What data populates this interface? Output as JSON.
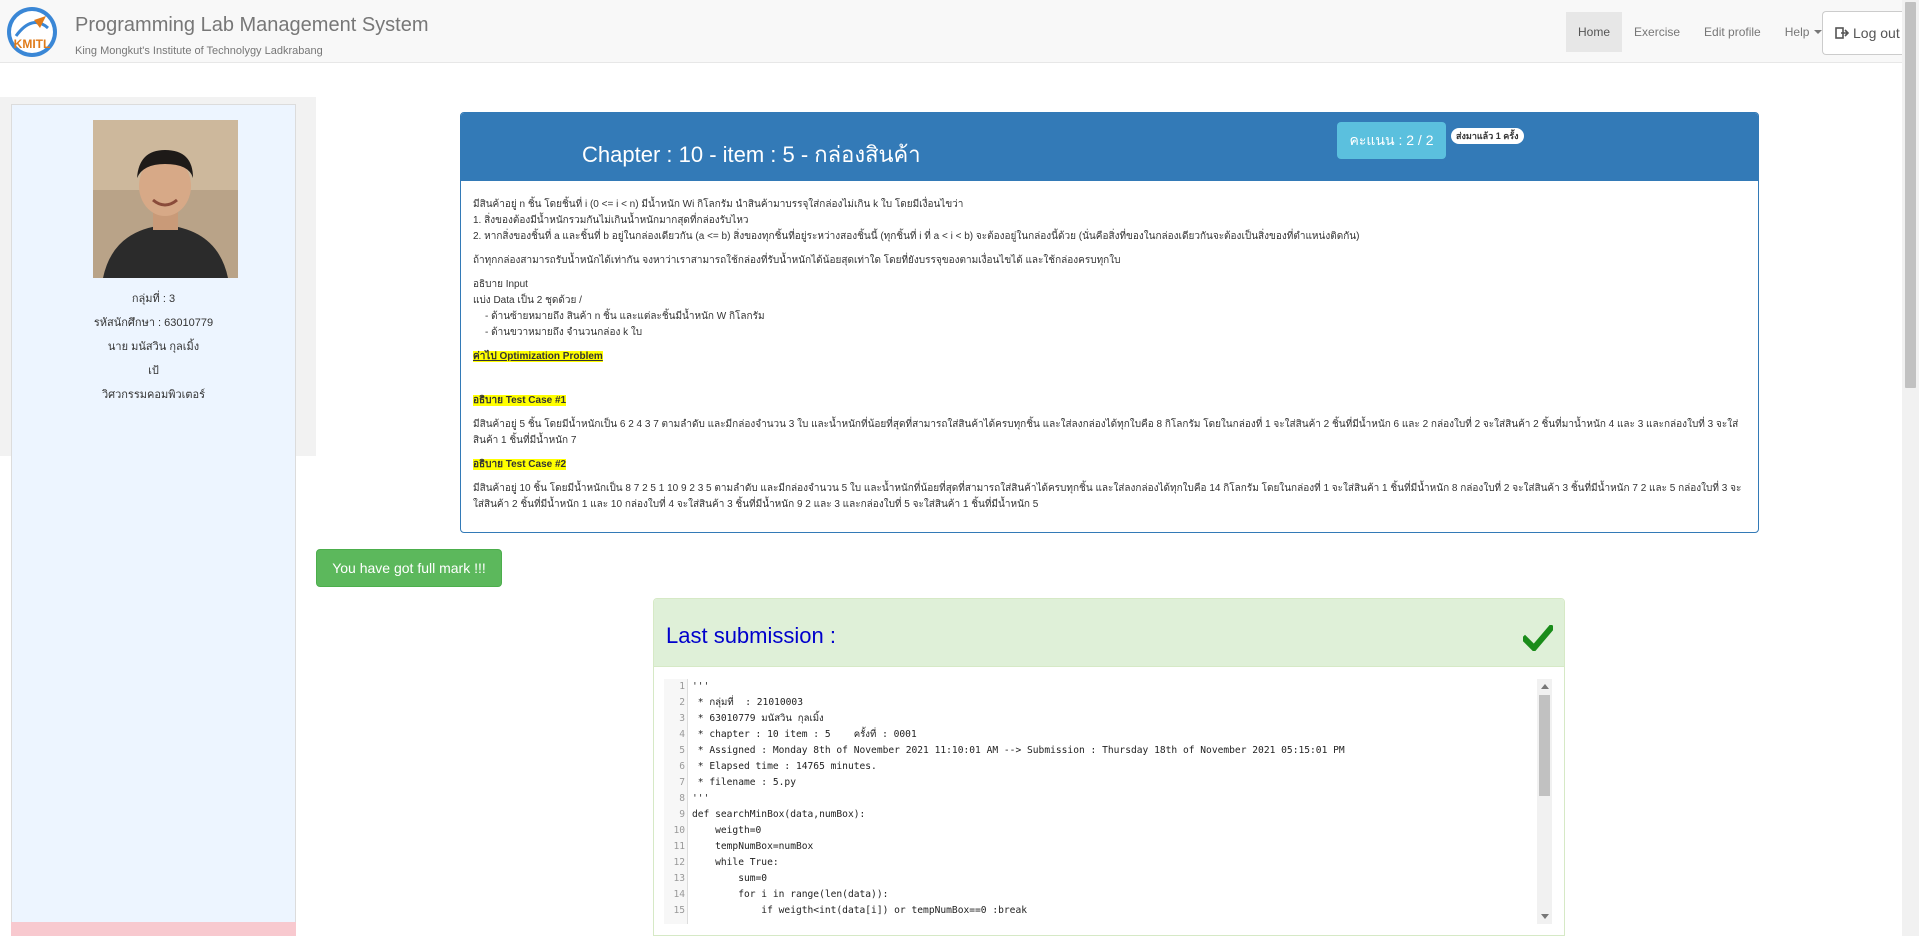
{
  "navbar": {
    "brand_title": "Programming Lab Management System",
    "brand_subtitle": "King Mongkut's Institute of Technolygy Ladkrabang",
    "logo_text": "KMITL",
    "items": [
      {
        "label": "Home",
        "active": true
      },
      {
        "label": "Exercise",
        "active": false
      },
      {
        "label": "Edit profile",
        "active": false
      },
      {
        "label": "Help",
        "active": false,
        "dropdown": true
      }
    ],
    "logout_label": "Log out"
  },
  "sidebar": {
    "group": "กลุ่มที่ : 3",
    "student_id": "รหัสนักศึกษา : 63010779",
    "name": "นาย มนัสวิน กุลเมิ้ง",
    "nickname": "เป้",
    "department": "วิศวกรรมคอมพิวเตอร์"
  },
  "problem": {
    "title": "Chapter : 10 - item : 5 - กล่องสินค้า",
    "score": "คะแนน : 2 / 2",
    "submit_count": "ส่งมาแล้ว 1 ครั้ง",
    "paragraphs": [
      "มีสินค้าอยู่ n ชิ้น โดยชิ้นที่ i (0 <= i < n) มีน้ำหนัก Wi กิโลกรัม นำสินค้ามาบรรจุใส่กล่องไม่เกิน k ใบ โดยมีเงื่อนไขว่า",
      "1. สิ่งของต้องมีน้ำหนักรวมกันไม่เกินน้ำหนักมากสุดที่กล่องรับไหว",
      "2. หากสิ่งของชิ้นที่ a และชิ้นที่ b อยู่ในกล่องเดียวกัน (a <= b) สิ่งของทุกชิ้นที่อยู่ระหว่างสองชิ้นนี้ (ทุกชิ้นที่ i ที่ a < i < b) จะต้องอยู่ในกล่องนี้ด้วย (นั่นคือสิ่งที่ของในกล่องเดียวกันจะต้องเป็นสิ่งของที่ตำแหน่งติดกัน)",
      "ถ้าทุกกล่องสามารถรับน้ำหนักได้เท่ากัน จงหาว่าเราสามารถใช้กล่องที่รับน้ำหนักได้น้อยสุดเท่าใด โดยที่ยังบรรจุของตามเงื่อนไขได้ และใช้กล่องครบทุกใบ",
      "อธิบาย Input",
      "แบ่ง Data เป็น 2 ชุดด้วย /",
      "-   ด้านซ้ายหมายถึง สินค้า n ชิ้น และแต่ละชิ้นมีน้ำหนัก W กิโลกรัม",
      "-   ด้านขวาหมายถึง จำนวนกล่อง k ใบ"
    ],
    "category_label": "ค่าไป Optimization Problem",
    "tc1_label": "อธิบาย Test Case #1",
    "tc1_text": "มีสินค้าอยู่ 5 ชิ้น โดยมีน้ำหนักเป็น 6 2 4 3 7 ตามลำดับ และมีกล่องจำนวน 3 ใบ   และน้ำหนักที่น้อยที่สุดที่สามารถใส่สินค้าได้ครบทุกชิ้น และใส่ลงกล่องได้ทุกใบคือ 8 กิโลกรัม โดยในกล่องที่ 1 จะใส่สินค้า 2 ชิ้นที่มีน้ำหนัก 6 และ 2   กล่องใบที่ 2 จะใส่สินค้า 2 ชิ้นที่มาน้ำหนัก 4 และ 3 และกล่องใบที่ 3 จะใส่สินค้า 1 ชิ้นที่มีน้ำหนัก 7",
    "tc2_label": "อธิบาย Test Case #2",
    "tc2_text": "มีสินค้าอยู่ 10 ชิ้น โดยมีน้ำหนักเป็น 8 7 2 5 1 10 9 2 3 5 ตามลำดับ และมีกล่องจำนวน 5 ใบ   และน้ำหนักที่น้อยที่สุดที่สามารถใส่สินค้าได้ครบทุกชิ้น และใส่ลงกล่องได้ทุกใบคือ 14 กิโลกรัม โดยในกล่องที่ 1 จะใส่สินค้า 1 ชิ้นที่มีน้ำหนัก 8   กล่องใบที่ 2 จะใส่สินค้า 3 ชิ้นที่มีน้ำหนัก 7 2 และ 5   กล่องใบที่ 3 จะใส่สินค้า 2 ชิ้นที่มีน้ำหนัก 1 และ 10   กล่องใบที่ 4 จะใส่สินค้า 3 ชิ้นที่มีน้ำหนัก 9 2 และ 3    และกล่องใบที่ 5 จะใส่สินค้า 1 ชิ้นที่มีน้ำหนัก 5"
  },
  "fullmark_label": "You have got full mark !!!",
  "submission": {
    "title": "Last submission :",
    "code_lines": [
      {
        "n": "1",
        "text": "'''"
      },
      {
        "n": "2",
        "text": " * กลุ่มที่  : 21010003"
      },
      {
        "n": "3",
        "text": " * 63010779 มนัสวิน กุลเมิ้ง"
      },
      {
        "n": "4",
        "text": " * chapter : 10 item : 5    ครั้งที่ : 0001"
      },
      {
        "n": "5",
        "text": " * Assigned : Monday 8th of November 2021 11:10:01 AM --> Submission : Thursday 18th of November 2021 05:15:01 PM"
      },
      {
        "n": "6",
        "text": " * Elapsed time : 14765 minutes."
      },
      {
        "n": "7",
        "text": " * filename : 5.py"
      },
      {
        "n": "8",
        "text": "'''"
      },
      {
        "n": "9",
        "text": "def searchMinBox(data,numBox):"
      },
      {
        "n": "10",
        "text": "    weigth=0"
      },
      {
        "n": "11",
        "text": "    tempNumBox=numBox"
      },
      {
        "n": "12",
        "text": "    while True:"
      },
      {
        "n": "13",
        "text": "        sum=0"
      },
      {
        "n": "14",
        "text": "        for i in range(len(data)):"
      },
      {
        "n": "15",
        "text": "            if weigth<int(data[i]) or tempNumBox==0 :break"
      }
    ]
  }
}
